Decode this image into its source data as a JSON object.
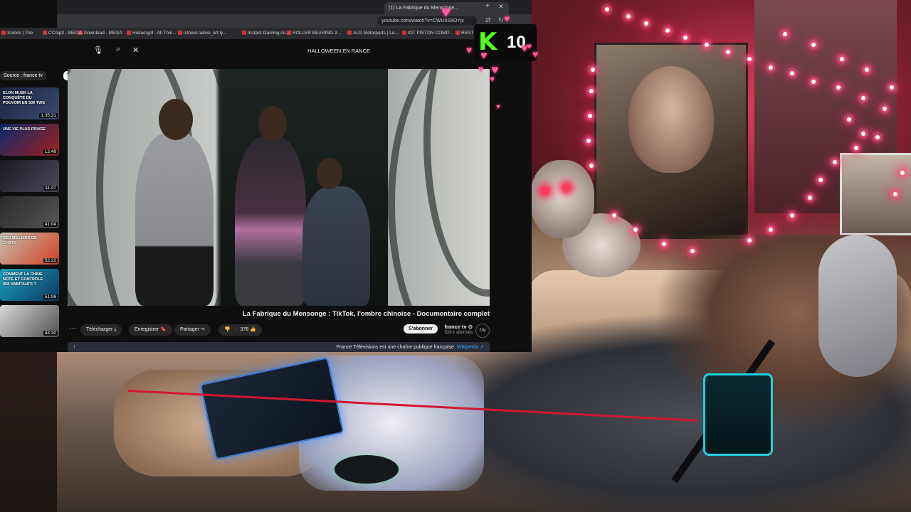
{
  "browser": {
    "tab_title": "(1) La Fabrique du Mensonge...",
    "url": "youtube.com/watch?v=CWU5S5OYjc",
    "bookmarks": [
      "RENTL",
      "IOT PISTON COMP...",
      "ALG Motorparts | La...",
      "ROLLER BEARING 2...",
      "Instant-Gaming.co...",
      "istoeel.railwo_art.ly...",
      "Hukacrypt - All Thin...",
      "Download - MEGA",
      "CCmp3 - MEGA",
      "Soloes | The"
    ]
  },
  "youtube": {
    "search_query": "HALLOWEEN EN RANCE",
    "filter_chips": [
      "Tout",
      "Source : france tv"
    ],
    "sidebar_videos": [
      {
        "caption": "ELON MUSK LA CONQUÊTE DU POUVOIR EN 300 TWS",
        "duration": "1:35:31"
      },
      {
        "caption": "UNE VIE PLUS PRIVÉE",
        "duration": "12:49"
      },
      {
        "caption": "",
        "duration": "11:47"
      },
      {
        "caption": "",
        "duration": "41:04"
      },
      {
        "caption": "DES MILLIERS DE CHATS",
        "duration": "52:22"
      },
      {
        "caption": "COMMENT LA CHINE NOTE ET CONTRÔLE 958 HABITANTS ?",
        "duration": "51:06"
      },
      {
        "caption": "",
        "duration": "43:30"
      }
    ],
    "video": {
      "title": "La Fabrique du Mensonge : TikTok, l'ombre chinoise - Documentaire complet",
      "channel_name": "france tv ⊙",
      "channel_subs": "528 k abonnés",
      "avatar_text": "f.tv",
      "subscribe_label": "S'abonner",
      "likes": "376",
      "share_label": "Partager",
      "save_label": "Enregistrer",
      "download_label": "Télécharger",
      "description": "France Télévisions est une chaîne publique française.",
      "description_link": "Wikipedia ↗",
      "watermark": "France TV"
    }
  },
  "overlay": {
    "kick_logo": "K",
    "kick_count": "10"
  },
  "colors": {
    "kick_green": "#53fc18",
    "youtube_bg": "#0f0f0f",
    "heart_pink": "#ff5aa0",
    "led_pink": "#ff5a8a"
  }
}
